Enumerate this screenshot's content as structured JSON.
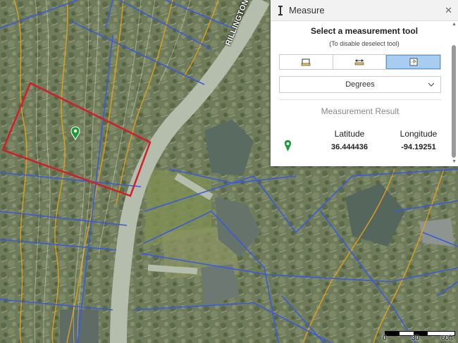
{
  "map": {
    "street_label": "RILLINGTON DR",
    "scale": {
      "labels": [
        "0",
        "30",
        "60ft"
      ]
    },
    "colors": {
      "parcel": "#3a5bd9",
      "contour": "#e3a21a",
      "selection": "#d01f2a",
      "marker": "#1e9a3b"
    },
    "marker_icon": "map-pin-icon"
  },
  "panel": {
    "title": "Measure",
    "title_icon": "ruler-icon",
    "close_icon": "close-icon",
    "heading": "Select a measurement tool",
    "subheading": "(To disable deselect tool)",
    "tools": [
      {
        "name": "area",
        "icon": "area-tool-icon",
        "active": false
      },
      {
        "name": "distance",
        "icon": "distance-tool-icon",
        "active": false
      },
      {
        "name": "location",
        "icon": "location-tool-icon",
        "active": true
      }
    ],
    "units_select": {
      "value": "Degrees"
    },
    "result_title": "Measurement Result",
    "latitude_label": "Latitude",
    "longitude_label": "Longitude",
    "latitude": "36.444436",
    "longitude": "-94.19251"
  }
}
